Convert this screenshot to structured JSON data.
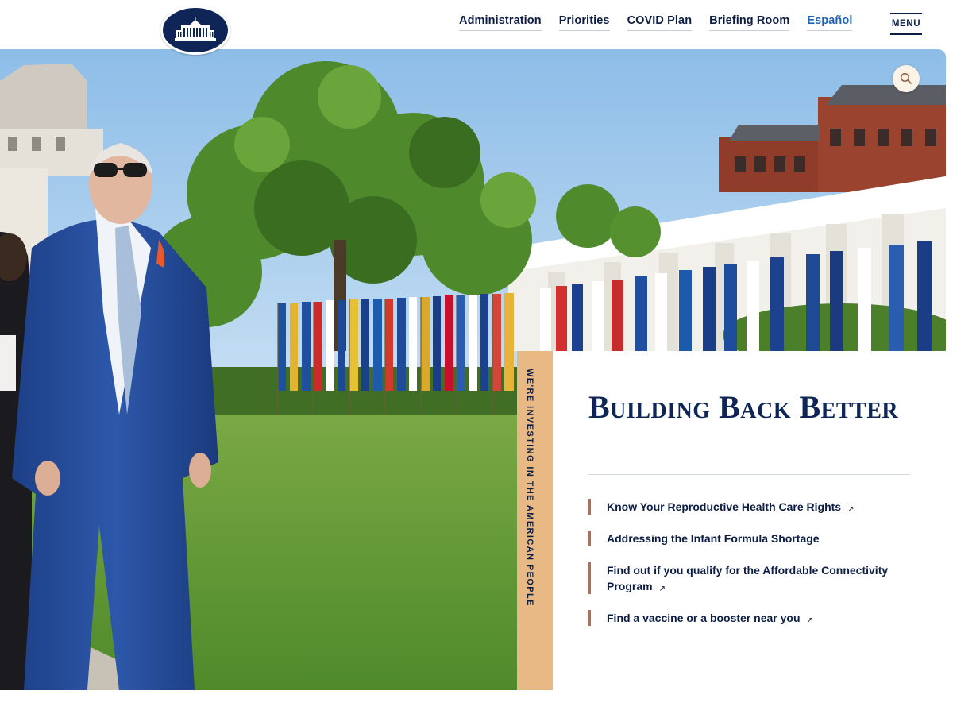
{
  "header": {
    "nav": [
      {
        "label": "Administration"
      },
      {
        "label": "Priorities"
      },
      {
        "label": "COVID Plan"
      },
      {
        "label": "Briefing Room"
      },
      {
        "label": "Español"
      }
    ],
    "menu_label": "MENU"
  },
  "hero": {
    "tag": "We're investing in the American people",
    "title": "Building Back Better",
    "links": [
      {
        "label": "Know Your Reproductive Health Care Rights",
        "external": true
      },
      {
        "label": "Addressing the Infant Formula Shortage",
        "external": false
      },
      {
        "label": "Find out if you qualify for the Affordable Connectivity Program",
        "external": true
      },
      {
        "label": "Find a vaccine or a booster near you",
        "external": true
      }
    ],
    "external_glyph": "↗"
  },
  "icons": {
    "logo": "white-house-seal-icon",
    "search": "search-icon",
    "menu": "hamburger-menu-icon",
    "external": "external-link-icon"
  },
  "colors": {
    "navy": "#0f2557",
    "text": "#0c1d44",
    "spanish_link": "#1f63b5",
    "tag_strip": "#e9b985",
    "link_accent": "#b56d4b"
  }
}
